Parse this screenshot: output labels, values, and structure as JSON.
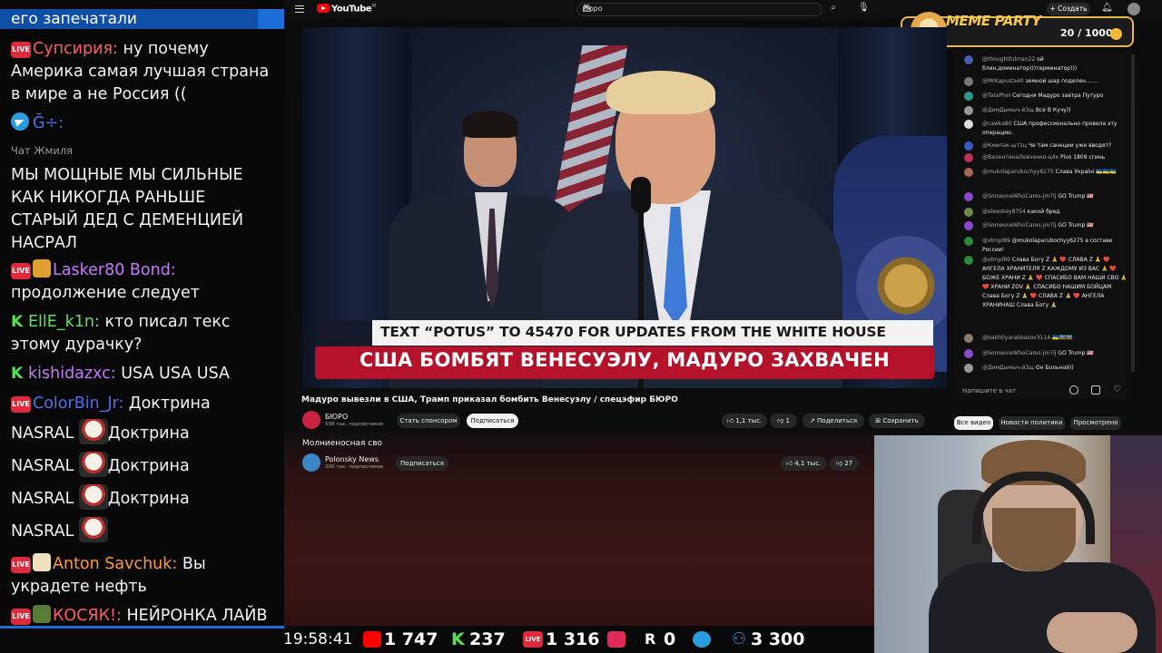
{
  "overlay_chat": {
    "top_text": "его запечатали",
    "messages": [
      {
        "user": "Супсирия:",
        "text": "ну почему Америка самая лучшая страна в мире а не Россия ((",
        "platform": "live"
      },
      {
        "user": "Ğ÷:",
        "text": "",
        "platform": "telegram"
      },
      {
        "user": "Чат Жмиля",
        "text": "МЫ МОЩНЫЕ МЫ СИЛЬНЫЕ КАК НИКОГДА РАНЬШЕ СТАРЫЙ ДЕД С ДЕМЕНЦИЕЙ НАСРАЛ",
        "platform": "none"
      },
      {
        "user": "Lasker80 Bond:",
        "text": "продолжение следует",
        "platform": "live"
      },
      {
        "user": "EllE_k1n:",
        "text": "кто писал текс этому дурачку?",
        "platform": "kick"
      },
      {
        "user": "kishidazxc:",
        "text": "USA USA USA",
        "platform": "kick"
      },
      {
        "user": "ColorBin_Jr:",
        "text": "Доктрина",
        "platform": "live"
      },
      {
        "user": "",
        "text": "NASRAL",
        "platform": "none"
      },
      {
        "user": "Anton Savchuk:",
        "text": "Вы украдете нефть",
        "platform": "live"
      },
      {
        "user": "КОСЯК!:",
        "text": "НЕЙРОНКА ЛАЙВ НЕ ПЕРЕВОДИТ",
        "platform": "live"
      }
    ],
    "doctrine_word": "Доктрина",
    "nasral_word": "NASRAL"
  },
  "header": {
    "logo_text": "YouTube",
    "logo_region": "AT",
    "search_value": "бюро",
    "create_label": "Создать"
  },
  "video": {
    "lower_bar_text": "TEXT “POTUS” TO 45470 FOR UPDATES FROM THE WHITE HOUSE",
    "lower_red_text": "США БОМБЯТ ВЕНЕСУЭЛУ, МАДУРО ЗАХВАЧЕН",
    "title": "Мадуро вывезли в США, Трамп приказал бомбить Венесуэлу / спецэфир БЮРО",
    "channel": "БЮРО",
    "subs": "598 тыс. подписчиков",
    "sponsor_label": "Стать спонсором",
    "subscribe_label": "Подписаться",
    "likes": "1,1 тыс.",
    "dislikes": "1",
    "share_label": "Поделиться",
    "save_label": "Сохранить"
  },
  "tabs": [
    "Все видео",
    "Новости политики",
    "Просмотрено"
  ],
  "next_video": {
    "title": "Молниеносная сво",
    "channel": "Polonsky News",
    "subs": "200 тыс. подписчиков",
    "subscribe_label": "Подписаться",
    "likes": "4,1 тыс.",
    "dislikes": "27"
  },
  "yt_chat": {
    "messages": [
      {
        "name": "@thoughtfulman22",
        "text": "ой блин,доминатор)))терминатор)))",
        "color": "#4a5ab0"
      },
      {
        "name": "@MrKapusta40",
        "text": "земной шар поделен.......",
        "color": "#777"
      },
      {
        "name": "@TataPhel",
        "text": "Сегодня Мадуро завтра Путуро",
        "color": "#2a9a8a"
      },
      {
        "name": "@ДимДымыч-й3щ",
        "text": "Все В Кучу))",
        "color": "#999"
      },
      {
        "name": "@cawka80",
        "text": "США профессионально провела эту операцию.",
        "color": "#ddd"
      },
      {
        "name": "@Кмипак-шт1ц",
        "text": "Че там санкции уже вводят?",
        "color": "#3a5ac0"
      },
      {
        "name": "@ВалентинаЛевченко-ц4х",
        "text": "Pivo 1809 сгинь",
        "color": "#c0305a"
      },
      {
        "name": "@mukolaparubochyy6275",
        "text": "Слава Україні 🇺🇦🇺🇦🇺🇦",
        "color": "#aa6655"
      },
      {
        "name": "@SomeoneWhoCares-jm7lj",
        "text": "GO Trump 🇺🇸",
        "color": "#8a4ad0"
      },
      {
        "name": "@alexokey8754",
        "text": "какой бред",
        "color": "#6a8a4a"
      },
      {
        "name": "@SomeoneWhoCares-jm7lj",
        "text": "GO Trump 🇺🇸",
        "color": "#8a4ad0"
      },
      {
        "name": "@xtmpl69",
        "text": "@mukolaparubochyy6275 в составе России!",
        "color": "#2a8a3a"
      },
      {
        "name": "@xtmpl69",
        "text": "Слава Богу Z 🙏 ❤️ СЛАВА Z 🙏 ❤️ АНГЕЛА ХРАНИТЕЛЯ Z КАЖДОМУ ИЗ ВАС 🙏 ❤️ БОЖЕ ХРАНИ Z 🙏 ❤️ СПАСИБО ВАМ НАШИ СВО 🙏 ❤️ ХРАНИ ZOV 🙏 СПАСИБО НАШИМ БОЙЦАМ Слава Богу Z 🙏 ❤️ СЛАВА Z 🙏 ❤️ АНГЕЛА ХРАНИНАШ Слава Богу 🙏",
        "color": "#2a8a3a"
      },
      {
        "name": "@bakhtiyarabbasov3114",
        "text": "🇺🇦🇦🇿🇦🇿",
        "color": "#8a7a6a"
      },
      {
        "name": "@SomeoneWhoCares-jm7lj",
        "text": "GO Trump 🇺🇸",
        "color": "#8a4ad0"
      },
      {
        "name": "@ДимДымыч-й3щ",
        "text": "Он Больной))",
        "color": "#999"
      }
    ],
    "input_placeholder": "Напишите в чат"
  },
  "meme_party": {
    "title": "MEME PARTY",
    "count": "20 / 1000"
  },
  "stats": {
    "time": "19:58:41",
    "youtube": "1 747",
    "kick": "237",
    "live": "1 316",
    "rutube": "0",
    "telegram": "3 300"
  },
  "colors": {
    "live_red": "#e02a3b",
    "kick_green": "#52e252",
    "overlay_blue": "#1c6ed6",
    "lower_red": "#b4122a",
    "meme_gold": "#f8c94b"
  }
}
